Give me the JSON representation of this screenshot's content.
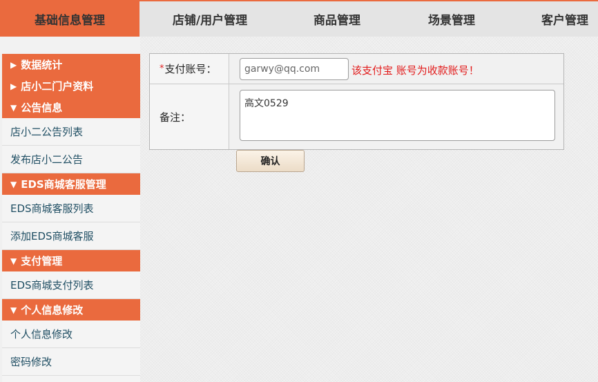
{
  "topnav": {
    "tabs": [
      {
        "label": "基础信息管理",
        "active": true
      },
      {
        "label": "店铺/用户管理",
        "active": false
      },
      {
        "label": "商品管理",
        "active": false
      },
      {
        "label": "场景管理",
        "active": false
      },
      {
        "label": "客户管理",
        "active": false
      }
    ]
  },
  "sidebar": {
    "groups": [
      {
        "label": "数据统计",
        "arrow": "▶"
      },
      {
        "label": "店小二门户资料",
        "arrow": "▶"
      },
      {
        "label": "公告信息",
        "arrow": "▼",
        "items": [
          "店小二公告列表",
          "发布店小二公告"
        ]
      },
      {
        "label": "EDS商城客服管理",
        "arrow": "▼",
        "items": [
          "EDS商城客服列表",
          "添加EDS商城客服"
        ]
      },
      {
        "label": "支付管理",
        "arrow": "▼",
        "items": [
          "EDS商城支付列表"
        ]
      },
      {
        "label": "个人信息修改",
        "arrow": "▼",
        "items": [
          "个人信息修改",
          "密码修改"
        ]
      }
    ]
  },
  "form": {
    "account": {
      "required_mark": "*",
      "label": "支付账号：",
      "value": "garwy@qq.com",
      "hint": "该支付宝 账号为收款账号！"
    },
    "note": {
      "label": "备注：",
      "value": "高文0529"
    },
    "confirm_label": "确认"
  },
  "colors": {
    "accent": "#ea6a3e",
    "hint_red": "#e21a1a",
    "sidebar_link": "#1f4e63"
  }
}
